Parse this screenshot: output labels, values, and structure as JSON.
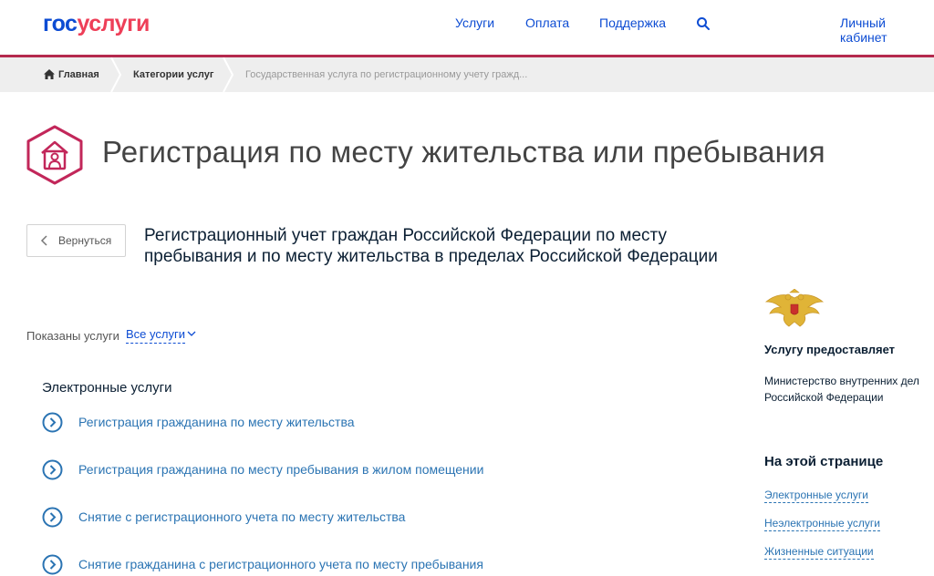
{
  "header": {
    "logo_part1": "гос",
    "logo_part2": "услуги",
    "nav": [
      "Услуги",
      "Оплата",
      "Поддержка"
    ],
    "search_icon": "search-icon",
    "account": "Личный кабинет"
  },
  "breadcrumbs": {
    "home": "Главная",
    "category": "Категории услуг",
    "current": "Государственная услуга по регистрационному учету гражд..."
  },
  "page": {
    "title_icon": "house-person-icon",
    "title": "Регистрация по месту жительства или пребывания",
    "back_label": "Вернуться",
    "service_heading": "Регистрационный учет граждан Российской Федерации по месту пребывания и по месту жительства в пределах Российской Федерации"
  },
  "filter": {
    "label": "Показаны услуги",
    "selected": "Все услуги"
  },
  "electronic_services": {
    "heading": "Электронные услуги",
    "items": [
      "Регистрация гражданина по месту жительства",
      "Регистрация гражданина по месту пребывания в жилом помещении",
      "Снятие с регистрационного учета по месту жительства",
      "Снятие гражданина с регистрационного учета по месту пребывания"
    ]
  },
  "provider": {
    "emblem": "double-headed-eagle-emblem",
    "title": "Услугу предоставляет",
    "name_line1": "Министерство внутренних дел",
    "name_line2": "Российской Федерации"
  },
  "on_this_page": {
    "title": "На этой странице",
    "links": [
      "Электронные услуги",
      "Неэлектронные услуги",
      "Жизненные ситуации"
    ]
  },
  "colors": {
    "brand_blue": "#0d4cd3",
    "brand_red": "#ee3f58",
    "accent_bar": "#b5294e",
    "link": "#2b74b3",
    "icon_magenta": "#c2275a"
  }
}
